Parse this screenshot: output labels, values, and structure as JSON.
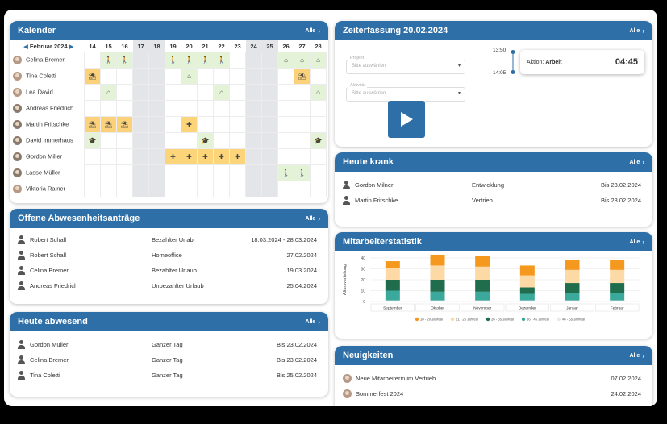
{
  "calendar": {
    "title": "Kalender",
    "all": "Alle",
    "month": "Februar 2024",
    "days": [
      "14",
      "15",
      "16",
      "17",
      "18",
      "19",
      "20",
      "21",
      "22",
      "23",
      "24",
      "25",
      "26",
      "27",
      "28"
    ],
    "weekend_idx": [
      3,
      4,
      10,
      11
    ],
    "people": [
      {
        "name": "Celina Bremer",
        "g": "f",
        "cells": {
          "1": "trip",
          "2": "trip",
          "5": "trip",
          "6": "trip",
          "7": "trip",
          "8": "trip",
          "12": "ho",
          "13": "ho",
          "14": "ho"
        }
      },
      {
        "name": "Tina Coletti",
        "g": "f",
        "cells": {
          "0": "vac",
          "6": "ho",
          "13": "vac"
        }
      },
      {
        "name": "Lea David",
        "g": "f",
        "cells": {
          "1": "ho",
          "8": "ho",
          "14": "ho"
        }
      },
      {
        "name": "Andreas Friedrich",
        "g": "m",
        "cells": {}
      },
      {
        "name": "Martin Fritschke",
        "g": "m",
        "cells": {
          "0": "vac",
          "1": "vac",
          "2": "vac",
          "6": "sick"
        }
      },
      {
        "name": "David Immerhaus",
        "g": "m",
        "cells": {
          "0": "train",
          "7": "train",
          "14": "train"
        }
      },
      {
        "name": "Gordon Miller",
        "g": "m",
        "cells": {
          "5": "sick",
          "6": "sick",
          "7": "sick",
          "8": "sick",
          "9": "sick"
        }
      },
      {
        "name": "Lasse Müller",
        "g": "m",
        "cells": {
          "12": "trip",
          "13": "trip"
        }
      },
      {
        "name": "Viktoria Rainer",
        "g": "f",
        "cells": {}
      }
    ]
  },
  "requests": {
    "title": "Offene Abwesenheitsanträge",
    "all": "Alle",
    "rows": [
      {
        "name": "Robert Schall",
        "type": "Bezahlter Urlab",
        "date": "18.03.2024 - 28.03.2024"
      },
      {
        "name": "Robert Schall",
        "type": "Homeoffice",
        "date": "27.02.2024"
      },
      {
        "name": "Celina Bremer",
        "type": "Bezahlter Urlaub",
        "date": "19.03.2024"
      },
      {
        "name": "Andreas Friedrich",
        "type": "Unbezahlter Urlaub",
        "date": "25.04.2024"
      }
    ]
  },
  "absent": {
    "title": "Heute abwesend",
    "all": "Alle",
    "rows": [
      {
        "name": "Gordon Müller",
        "type": "Ganzer Tag",
        "date": "Bis 23.02.2024"
      },
      {
        "name": "Celina Bremer",
        "type": "Ganzer Tag",
        "date": "Bis 23.02.2024"
      },
      {
        "name": "Tina Coletti",
        "type": "Ganzer Tag",
        "date": "Bis 25.02.2024"
      }
    ]
  },
  "timetrack": {
    "title": "Zeiterfassung 20.02.2024",
    "all": "Alle",
    "project_label": "Projekt",
    "project_value": "Bitte auswählen",
    "activity_label": "Aktivität",
    "activity_value": "Bitte auswählen",
    "time_start": "13:50",
    "time_end": "14:05",
    "action_label": "Aktion:",
    "action_value": "Arbeit",
    "duration": "04:45"
  },
  "sick": {
    "title": "Heute krank",
    "all": "Alle",
    "rows": [
      {
        "name": "Gordon Milner",
        "type": "Entwicklung",
        "date": "Bis 23.02.2024"
      },
      {
        "name": "Martin Fritschke",
        "type": "Vertrieb",
        "date": "Bis 28.02.2024"
      }
    ]
  },
  "stats": {
    "title": "Mitarbeiterstatistik",
    "all": "Alle"
  },
  "chart_data": {
    "type": "bar",
    "stacked": true,
    "ylabel": "Altersverteilung",
    "ylim": [
      0,
      40
    ],
    "yticks": [
      0,
      10,
      20,
      30,
      40
    ],
    "categories": [
      "September",
      "Oktober",
      "November",
      "Dezember",
      "Januar",
      "Februar"
    ],
    "series": [
      {
        "name": "46 - 55 Jahreal",
        "color": "#e8e8e8",
        "values": [
          1,
          1,
          1,
          1,
          1,
          1
        ]
      },
      {
        "name": "36 - 45 Jahreal",
        "color": "#3aa89b",
        "values": [
          9,
          8,
          8,
          6,
          7,
          7
        ]
      },
      {
        "name": "26 - 35 Jahreal",
        "color": "#1f6d4c",
        "values": [
          10,
          11,
          11,
          6,
          9,
          9
        ]
      },
      {
        "name": "21 - 25 Jahreal",
        "color": "#fdd9a6",
        "values": [
          11,
          13,
          12,
          11,
          12,
          12
        ]
      },
      {
        "name": "18 - 20 Jahreal",
        "color": "#f5981e",
        "values": [
          6,
          10,
          10,
          9,
          9,
          9
        ]
      }
    ],
    "legend_order": [
      "18 - 20 Jahreal",
      "21 - 25 Jahreal",
      "26 - 35 Jahreal",
      "36 - 45 Jahreal",
      "46 - 55 Jahreal"
    ],
    "legend": "bottom"
  },
  "news": {
    "title": "Neuigkeiten",
    "all": "Alle",
    "rows": [
      {
        "name": "Neue Mitarbeiterin im Vertrieb",
        "date": "07.02.2024"
      },
      {
        "name": "Sommerfest 2024",
        "date": "24.02.2024"
      }
    ]
  }
}
